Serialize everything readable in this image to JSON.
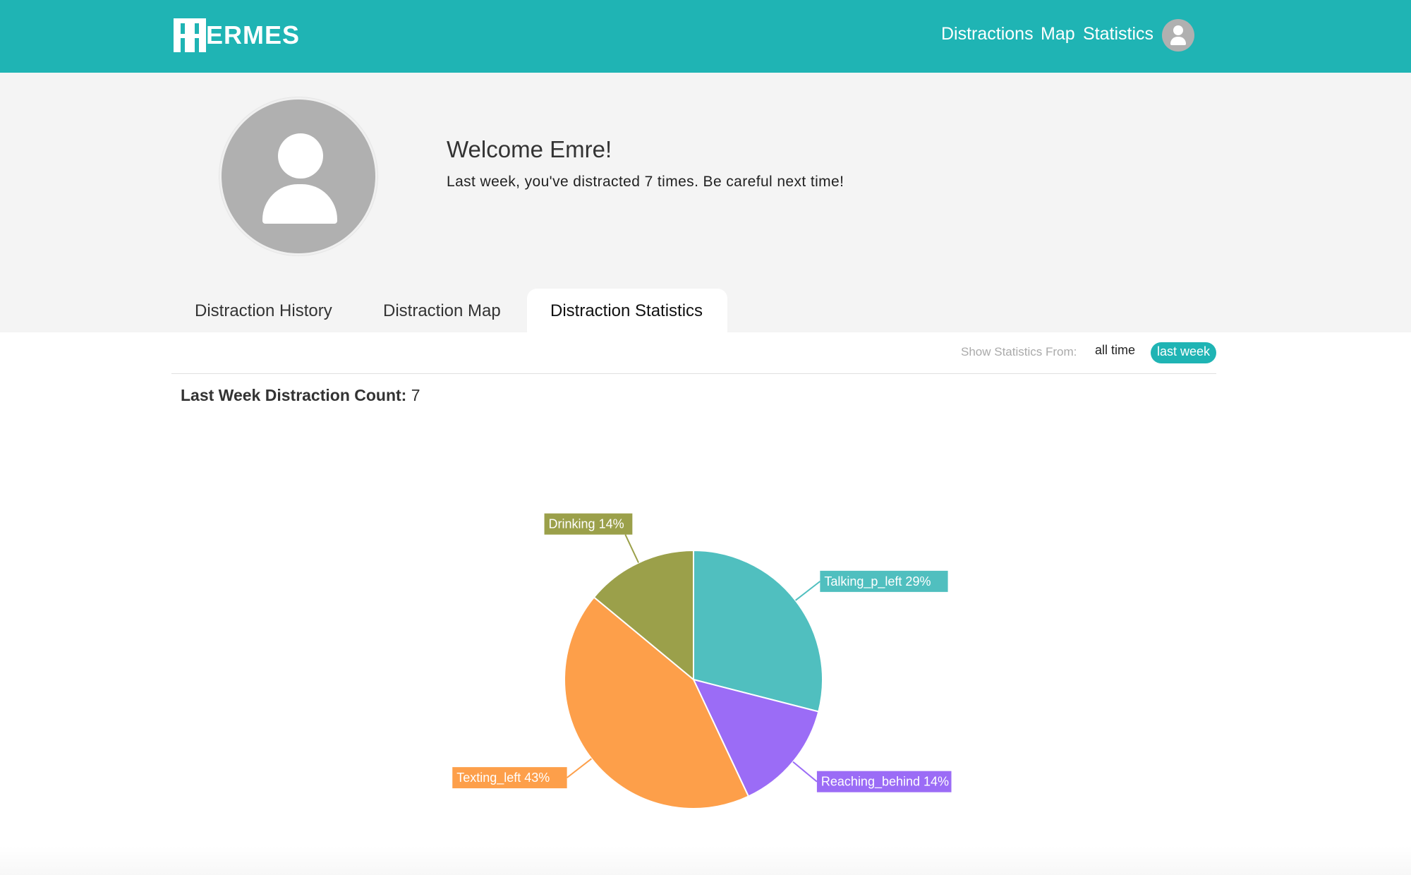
{
  "navbar": {
    "logo_text": "ERMES",
    "links": [
      {
        "label": "Distractions"
      },
      {
        "label": "Map"
      },
      {
        "label": "Statistics"
      }
    ]
  },
  "profile": {
    "welcome": "Welcome Emre!",
    "subtitle": "Last week, you've distracted 7 times. Be careful next time!"
  },
  "tabs": [
    {
      "label": "Distraction History",
      "active": false
    },
    {
      "label": "Distraction Map",
      "active": false
    },
    {
      "label": "Distraction Statistics",
      "active": true
    }
  ],
  "filter": {
    "label": "Show Statistics From:",
    "options": [
      {
        "label": "all time",
        "selected": false
      },
      {
        "label": "last week",
        "selected": true
      }
    ]
  },
  "summary": {
    "count_label": "Last Week Distraction Count:",
    "count_value": "7"
  },
  "colors": {
    "brand": "#1fb4b4",
    "page_bg": "#f4f4f4"
  },
  "chart_data": {
    "type": "pie",
    "slices": [
      {
        "label": "Talking_p_left",
        "value": 29,
        "display": "Talking_p_left 29%",
        "color": "#50bfbf"
      },
      {
        "label": "Reaching_behind",
        "value": 14,
        "display": "Reaching_behind 14%",
        "color": "#9b6cf6"
      },
      {
        "label": "Texting_left",
        "value": 43,
        "display": "Texting_left 43%",
        "color": "#fd9f4a"
      },
      {
        "label": "Drinking",
        "value": 14,
        "display": "Drinking 14%",
        "color": "#9ba04a"
      }
    ]
  }
}
